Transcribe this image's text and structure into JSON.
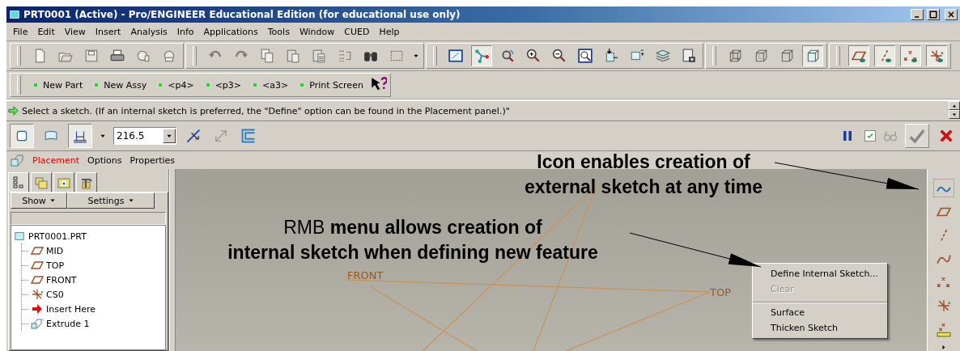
{
  "window": {
    "title": "PRT0001 (Active) - Pro/ENGINEER Educational Edition (for educational use only)"
  },
  "menu": [
    "File",
    "Edit",
    "View",
    "Insert",
    "Analysis",
    "Info",
    "Applications",
    "Tools",
    "Window",
    "CUED",
    "Help"
  ],
  "quick_buttons": [
    "New Part",
    "New Assy",
    "<p4>",
    "<p3>",
    "<a3>",
    "Print Screen"
  ],
  "message": "Select a sketch. (If an internal sketch is preferred, the \"Define\" option can be found in the Placement panel.)\"",
  "dashboard": {
    "depth_value": "216.5",
    "preview_checked": true
  },
  "dashboard_tabs": [
    {
      "label": "Placement",
      "selected": true
    },
    {
      "label": "Options",
      "selected": false
    },
    {
      "label": "Properties",
      "selected": false
    }
  ],
  "model_tree": {
    "buttons": [
      "Show",
      "Settings"
    ],
    "root": {
      "label": "PRT0001.PRT",
      "children": [
        {
          "label": "MID",
          "kind": "plane"
        },
        {
          "label": "TOP",
          "kind": "plane"
        },
        {
          "label": "FRONT",
          "kind": "plane"
        },
        {
          "label": "CS0",
          "kind": "csys"
        },
        {
          "label": "Insert Here",
          "kind": "insert"
        },
        {
          "label": "Extrude 1",
          "kind": "extrude"
        }
      ]
    }
  },
  "viewport": {
    "datum_labels": [
      "FRONT",
      "TOP"
    ]
  },
  "context_menu": [
    {
      "label": "Define Internal Sketch...",
      "disabled": false,
      "separator_before": false
    },
    {
      "label": "Clear",
      "disabled": true,
      "separator_before": false
    },
    {
      "label": "Surface",
      "disabled": false,
      "separator_before": true
    },
    {
      "label": "Thicken Sketch",
      "disabled": false,
      "separator_before": false
    }
  ],
  "annotations": [
    {
      "lines": [
        "Icon enables creation of",
        "external sketch at any time"
      ]
    },
    {
      "lead": "RMB",
      "lines": [
        "menu allows creation of",
        "internal sketch when defining new feature"
      ]
    }
  ]
}
